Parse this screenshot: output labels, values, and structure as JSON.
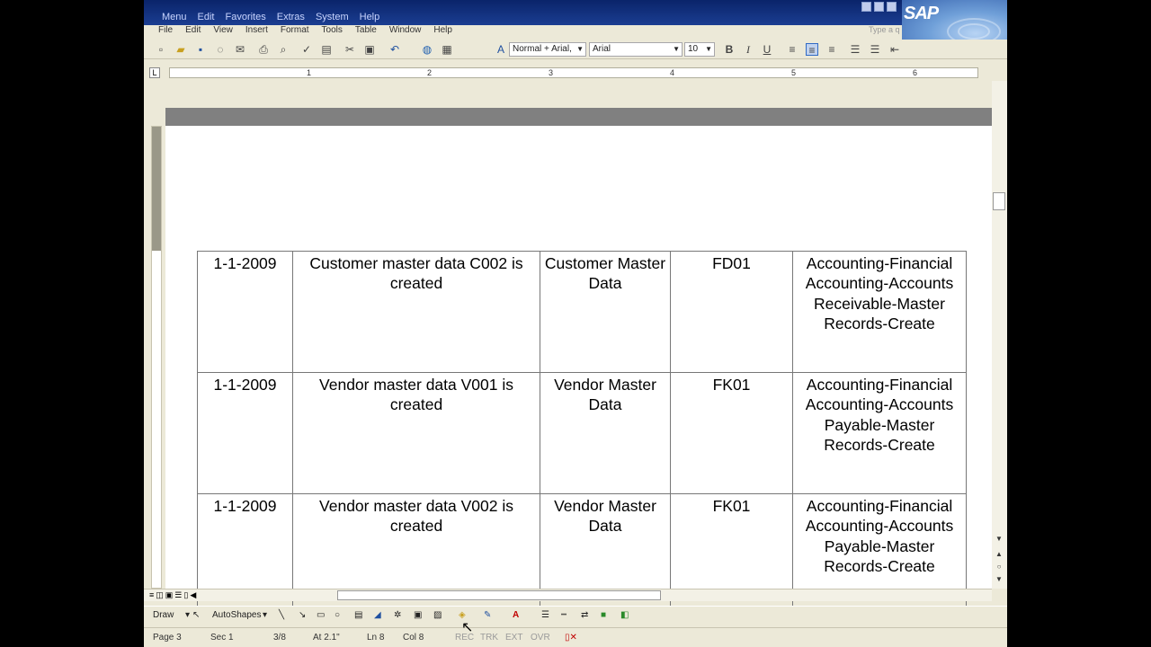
{
  "sap": {
    "menu": [
      "Menu",
      "Edit",
      "Favorites",
      "Extras",
      "System",
      "Help"
    ],
    "logo": "SAP"
  },
  "word": {
    "menu": [
      "File",
      "Edit",
      "View",
      "Insert",
      "Format",
      "Tools",
      "Table",
      "Window",
      "Help"
    ],
    "type_question": "Type a q",
    "style": "Normal + Arial,",
    "font": "Arial",
    "size": "10",
    "ruler_numbers": [
      "1",
      "2",
      "3",
      "4",
      "5",
      "6"
    ]
  },
  "table": {
    "rows": [
      {
        "date": "1-1-2009",
        "description": "Customer master data C002 is created",
        "object": "Customer Master Data",
        "tcode": "FD01",
        "path": "Accounting-Financial Accounting-Accounts Receivable-Master Records-Create"
      },
      {
        "date": "1-1-2009",
        "description": "Vendor master data V001 is created",
        "object": "Vendor Master Data",
        "tcode": "FK01",
        "path": "Accounting-Financial Accounting-Accounts Payable-Master Records-Create"
      },
      {
        "date": "1-1-2009",
        "description": "Vendor master data V002 is created",
        "object": "Vendor Master Data",
        "tcode": "FK01",
        "path": "Accounting-Financial Accounting-Accounts Payable-Master Records-Create"
      }
    ]
  },
  "drawbar": {
    "draw": "Draw",
    "autoshapes": "AutoShapes"
  },
  "status": {
    "page": "Page 3",
    "sec": "Sec 1",
    "pages": "3/8",
    "at": "At 2.1\"",
    "ln": "Ln 8",
    "col": "Col 8",
    "rec": "REC",
    "trk": "TRK",
    "ext": "EXT",
    "ovr": "OVR"
  }
}
